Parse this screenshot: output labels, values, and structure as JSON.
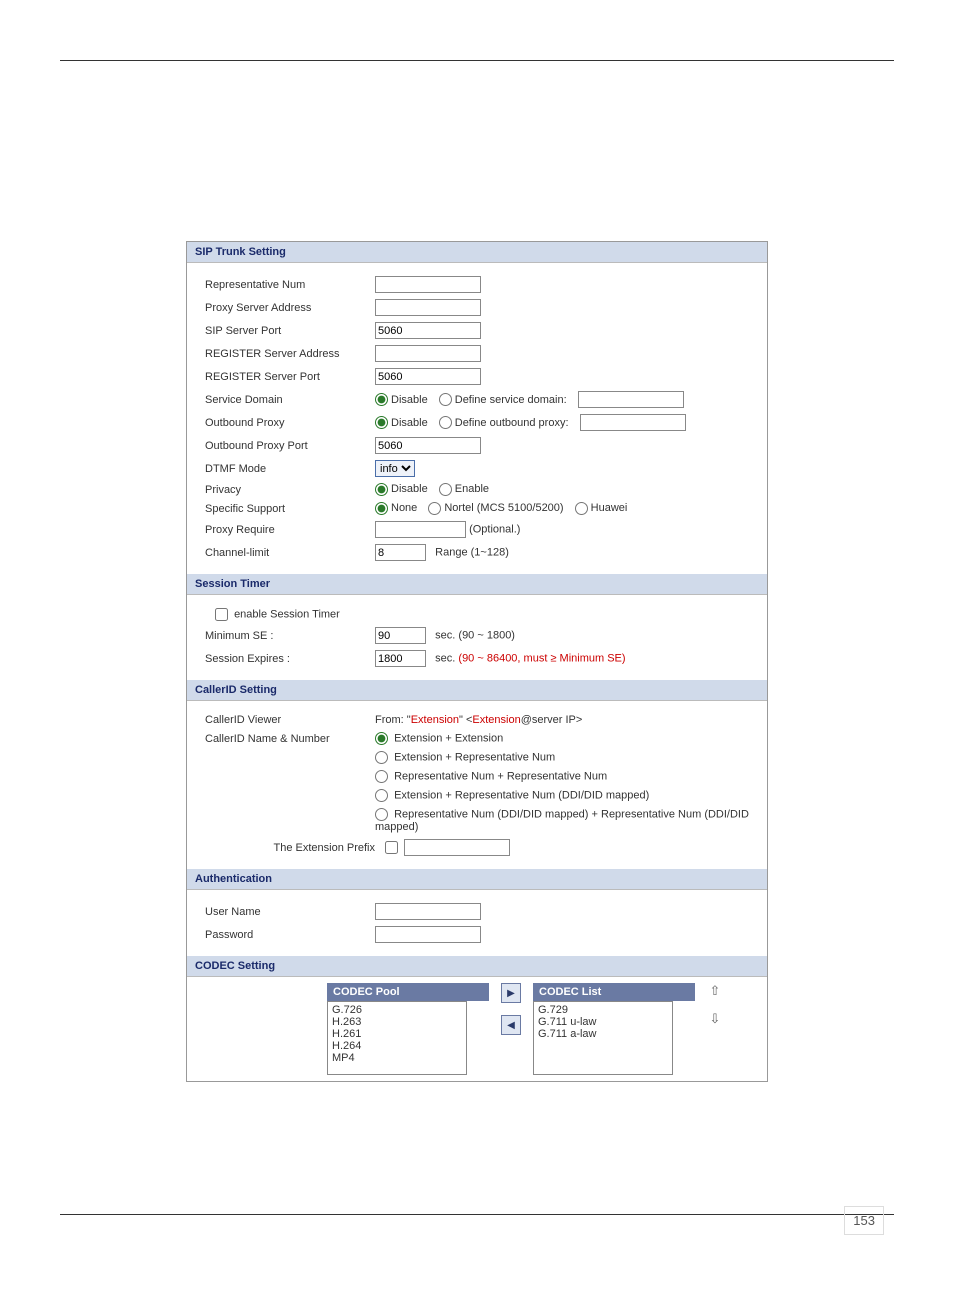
{
  "sip_trunk": {
    "header": "SIP Trunk Setting",
    "rep_num_label": "Representative Num",
    "rep_num_value": "",
    "proxy_addr_label": "Proxy Server Address",
    "proxy_addr_value": "",
    "sip_port_label": "SIP Server Port",
    "sip_port_value": "5060",
    "reg_addr_label": "REGISTER Server Address",
    "reg_addr_value": "",
    "reg_port_label": "REGISTER Server Port",
    "reg_port_value": "5060",
    "svc_domain_label": "Service Domain",
    "svc_domain_disable": "Disable",
    "svc_domain_define": "Define service domain:",
    "svc_domain_value": "",
    "ob_proxy_label": "Outbound Proxy",
    "ob_proxy_disable": "Disable",
    "ob_proxy_define": "Define outbound proxy:",
    "ob_proxy_value": "",
    "ob_port_label": "Outbound Proxy Port",
    "ob_port_value": "5060",
    "dtmf_label": "DTMF Mode",
    "dtmf_value": "info",
    "privacy_label": "Privacy",
    "privacy_disable": "Disable",
    "privacy_enable": "Enable",
    "specific_label": "Specific Support",
    "specific_none": "None",
    "specific_nortel": "Nortel (MCS 5100/5200)",
    "specific_huawei": "Huawei",
    "proxy_req_label": "Proxy Require",
    "proxy_req_value": "",
    "proxy_req_hint": "(Optional.)",
    "chan_limit_label": "Channel-limit",
    "chan_limit_value": "8",
    "chan_limit_hint": "Range (1~128)"
  },
  "session_timer": {
    "header": "Session Timer",
    "enable_label": "enable Session Timer",
    "min_se_label": "Minimum SE :",
    "min_se_value": "90",
    "min_se_hint": "sec. (90 ~ 1800)",
    "exp_label": "Session Expires :",
    "exp_value": "1800",
    "exp_prefix": "sec. ",
    "exp_hint": "(90 ~ 86400, must ≥ Minimum SE)"
  },
  "callerid": {
    "header": "CallerID Setting",
    "viewer_label": "CallerID Viewer",
    "viewer_from": "From: ",
    "viewer_q1": "\"",
    "viewer_ext1": "Extension",
    "viewer_mid": "\" <",
    "viewer_ext2": "Extension",
    "viewer_tail": "@server IP>",
    "name_num_label": "CallerID Name & Number",
    "opt1": "Extension + Extension",
    "opt2": "Extension + Representative Num",
    "opt3": "Representative Num + Representative Num",
    "opt4": "Extension + Representative Num (DDI/DID mapped)",
    "opt5": "Representative Num (DDI/DID mapped) + Representative Num (DDI/DID mapped)",
    "ext_prefix_label": "The Extension Prefix",
    "ext_prefix_value": ""
  },
  "auth": {
    "header": "Authentication",
    "user_label": "User Name",
    "user_value": "",
    "pass_label": "Password",
    "pass_value": ""
  },
  "codec": {
    "header": "CODEC Setting",
    "pool_header": "CODEC Pool",
    "list_header": "CODEC List",
    "pool": [
      "G.726",
      "H.263",
      "H.261",
      "H.264",
      "MP4"
    ],
    "list": [
      "G.729",
      "G.711 u-law",
      "G.711 a-law"
    ]
  },
  "page_number": "153"
}
